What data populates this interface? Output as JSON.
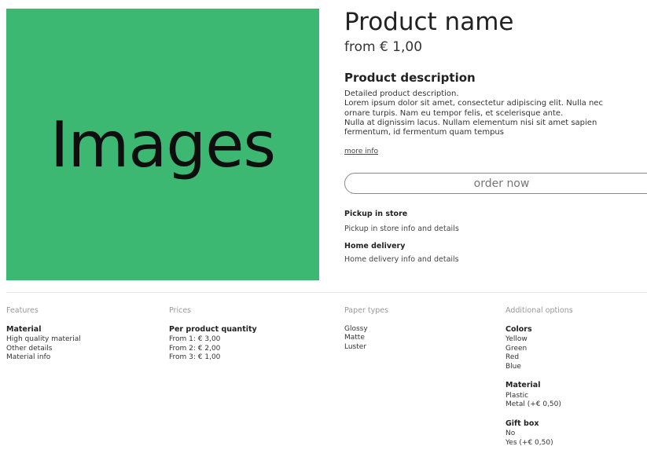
{
  "image_placeholder": "Images",
  "product": {
    "name": "Product name",
    "price": "from € 1,00",
    "description_title": "Product description",
    "description_lines": [
      "Detailed product description.",
      "Lorem ipsum dolor sit amet, consectetur adipiscing elit. Nulla nec",
      "ornare turpis. Nam eu tempor felis, et scelerisque ante.",
      "Nulla at dignissim lacus. Nullam elementum nisi sit amet sapien",
      "fermentum, id fermentum quam tempus"
    ],
    "more_info": "more info",
    "order_button": "order now"
  },
  "shipping": {
    "pickup_title": "Pickup in store",
    "pickup_text": "Pickup in store info and details",
    "delivery_title": "Home delivery",
    "delivery_text": "Home delivery info and details"
  },
  "features": {
    "heading": "Features",
    "subheading": "Material",
    "items": [
      "High quality material",
      "Other details",
      "Material info"
    ]
  },
  "prices": {
    "heading": "Prices",
    "subheading": "Per product quantity",
    "items": [
      "From 1: € 3,00",
      "From 2: € 2,00",
      "From 3: € 1,00"
    ]
  },
  "paper_types": {
    "heading": "Paper types",
    "items": [
      "Glossy",
      "Matte",
      "Luster"
    ]
  },
  "additional_options": {
    "heading": "Additional options",
    "colors_title": "Colors",
    "colors": [
      "Yellow",
      "Green",
      "Red",
      "Blue"
    ],
    "material_title": "Material",
    "material": [
      "Plastic",
      "Metal (+€ 0,50)"
    ],
    "giftbox_title": "Gift box",
    "giftbox": [
      "No",
      "Yes (+€ 0,50)"
    ]
  },
  "colors": {
    "image_bg": "#3db872"
  }
}
